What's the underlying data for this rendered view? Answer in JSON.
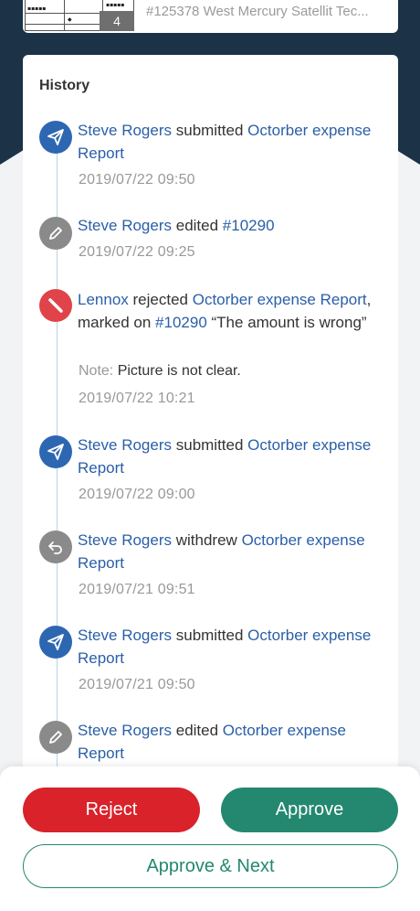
{
  "top_card": {
    "badge": "4",
    "title": "#125378 West Mercury Satellit Tec..."
  },
  "history": {
    "title": "History",
    "events": [
      {
        "type": "submitted",
        "icon": "send-icon",
        "color": "#2d67b2",
        "actor": "Steve Rogers",
        "action": "submitted",
        "target": "Octorber expense Report",
        "time": "2019/07/22  09:50"
      },
      {
        "type": "edited",
        "icon": "pencil-icon",
        "color": "#8a8a8a",
        "actor": "Steve Rogers",
        "action": "edited",
        "target": "#10290",
        "time": "2019/07/22  09:25"
      },
      {
        "type": "rejected",
        "icon": "reject-icon",
        "color": "#e04349",
        "actor": "Lennox",
        "action": "rejected",
        "target": "Octorber expense Report",
        "extra_text": ", marked on ",
        "extra_link": "#10290",
        "quote": "“The amount is wrong”",
        "note_label": "Note:",
        "note_text": "Picture is not clear.",
        "time": "2019/07/22  10:21"
      },
      {
        "type": "submitted",
        "icon": "send-icon",
        "color": "#2d67b2",
        "actor": "Steve Rogers",
        "action": "submitted",
        "target": "Octorber expense Report",
        "time": "2019/07/22  09:00"
      },
      {
        "type": "withdrew",
        "icon": "undo-icon",
        "color": "#8a8a8a",
        "actor": "Steve Rogers",
        "action": "withdrew",
        "target": "Octorber expense Report",
        "time": "2019/07/21  09:51"
      },
      {
        "type": "submitted",
        "icon": "send-icon",
        "color": "#2d67b2",
        "actor": "Steve Rogers",
        "action": "submitted",
        "target": "Octorber expense Report",
        "time": "2019/07/21  09:50"
      },
      {
        "type": "edited",
        "icon": "pencil-icon",
        "color": "#8a8a8a",
        "actor": "Steve Rogers",
        "action": "edited",
        "target": "Octorber expense Report",
        "time": ""
      }
    ]
  },
  "actions": {
    "reject_label": "Reject",
    "approve_label": "Approve",
    "approve_next_label": "Approve & Next"
  },
  "colors": {
    "link": "#2a5fa8",
    "reject": "#d9222a",
    "approve": "#23886f",
    "header_bg": "#1b3247"
  }
}
